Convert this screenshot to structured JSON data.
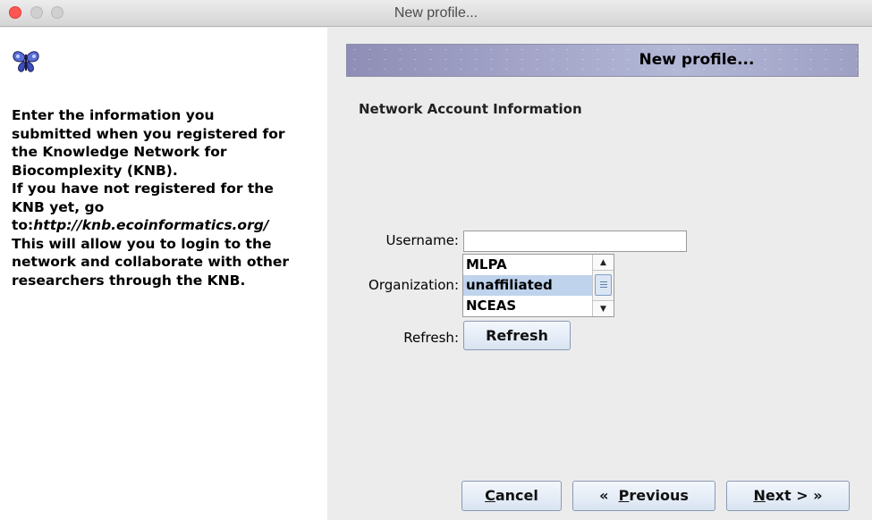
{
  "window": {
    "title": "New profile...",
    "controls": [
      "close",
      "minimize",
      "zoom"
    ]
  },
  "left_pane": {
    "logo_icon": "butterfly-icon",
    "instructions": {
      "line1": "Enter the information you",
      "line2": "submitted when you registered for",
      "line3": "the Knowledge Network for",
      "line4": "Biocomplexity (KNB).",
      "line5": "If you have not registered for the",
      "line6": "KNB yet, go",
      "line7_prefix": "to:",
      "line7_url": "http://knb.ecoinformatics.org/",
      "line8": "This will allow you to login to the",
      "line9": "network and collaborate with other",
      "line10": "researchers through the KNB."
    }
  },
  "main": {
    "banner_title": "New profile...",
    "section_heading": "Network Account Information",
    "username": {
      "label": "Username:",
      "value": ""
    },
    "organization": {
      "label": "Organization:",
      "visible_options": [
        "MLPA",
        "unaffiliated",
        "NCEAS"
      ],
      "selected": "unaffiliated"
    },
    "refresh": {
      "label": "Refresh:",
      "button_label": "Refresh"
    }
  },
  "footer": {
    "cancel": {
      "mnemonic": "C",
      "rest": "ancel"
    },
    "previous": {
      "icon": "«",
      "mnemonic": "P",
      "rest": "revious"
    },
    "next": {
      "mnemonic": "N",
      "rest": "ext >",
      "icon": "»"
    }
  },
  "colors": {
    "close_button": "#fc5753",
    "selection": "#bfd3ec",
    "button_border": "#8a99b4",
    "banner": "#a3a4c8"
  }
}
